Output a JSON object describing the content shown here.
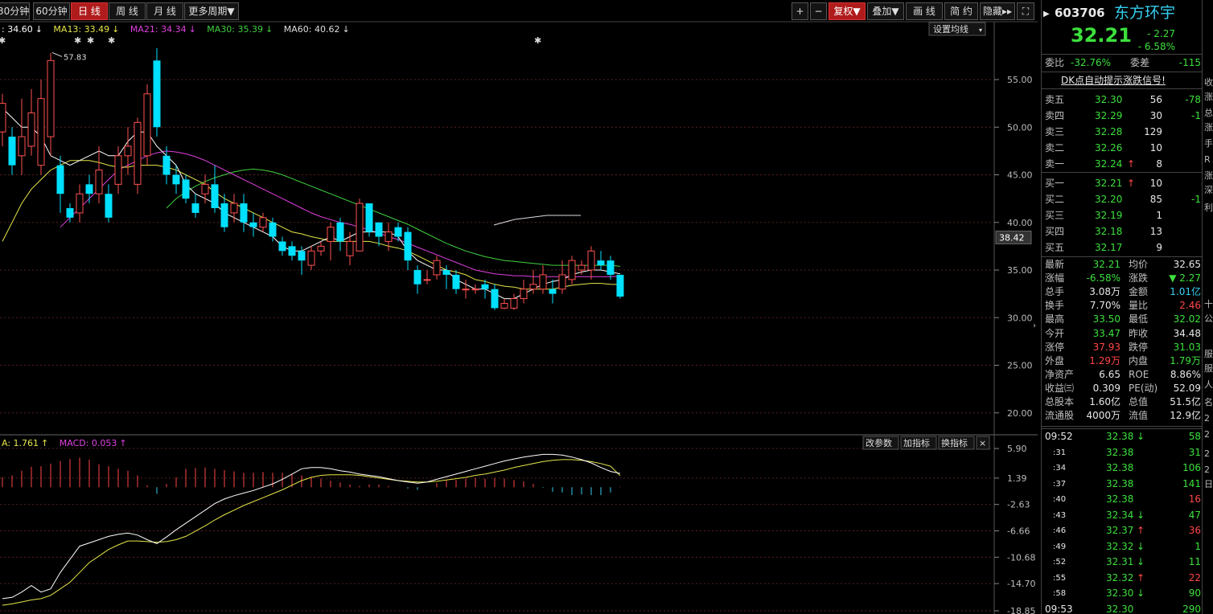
{
  "toolbar": {
    "periods": [
      {
        "label": "30分钟",
        "active": false
      },
      {
        "label": "60分钟",
        "active": false
      },
      {
        "label": "日 线",
        "active": true
      },
      {
        "label": "周 线",
        "active": false
      },
      {
        "label": "月 线",
        "active": false
      },
      {
        "label": "更多周期▼",
        "active": false
      }
    ],
    "right": [
      {
        "label": "+",
        "active": false
      },
      {
        "label": "−",
        "active": false
      },
      {
        "label": "复权▼",
        "active": true
      },
      {
        "label": "叠加▼",
        "active": false
      },
      {
        "label": "画 线",
        "active": false
      },
      {
        "label": "简 约",
        "active": false
      },
      {
        "label": "隐藏▸▸",
        "active": false
      },
      {
        "label": "⛶",
        "active": false
      }
    ]
  },
  "chart": {
    "settings_label": "设置均线",
    "ma_legend": [
      {
        "text": ": 34.60",
        "arrow": "↓",
        "color": "#ffffff"
      },
      {
        "text": "MA13: 33.49",
        "arrow": "↓",
        "color": "#e6e64a"
      },
      {
        "text": "MA21: 34.34",
        "arrow": "↓",
        "color": "#e040e0"
      },
      {
        "text": "MA30: 35.39",
        "arrow": "↓",
        "color": "#40d040"
      },
      {
        "text": "MA60: 40.62",
        "arrow": "↓",
        "color": "#dddddd"
      }
    ],
    "price_axis": [
      "55.00",
      "50.00",
      "45.00",
      "40.00",
      "35.00",
      "30.00",
      "25.00",
      "20.00"
    ],
    "current_price_tag": "38.42",
    "high_marker": "57.83",
    "macd_legend": [
      {
        "text": "A: 1.761",
        "arrow": "↑",
        "color": "#e6e64a"
      },
      {
        "text": "MACD: 0.053",
        "arrow": "↑",
        "color": "#e040e0"
      }
    ],
    "macd_buttons": [
      "改参数",
      "加指标",
      "换指标",
      "×"
    ],
    "macd_axis": [
      "5.90",
      "1.39",
      "-2.63",
      "-6.66",
      "-10.68",
      "-14.70",
      "-18.85"
    ]
  },
  "chart_data": {
    "type": "candlestick",
    "y_range": [
      17.5,
      58.5
    ],
    "candles": [
      [
        49.5,
        52.5,
        53.5,
        48
      ],
      [
        49,
        46,
        50,
        45
      ],
      [
        47,
        49,
        53,
        45
      ],
      [
        48,
        51.5,
        54,
        47
      ],
      [
        46,
        53,
        55,
        45
      ],
      [
        49,
        57,
        57.8,
        47
      ],
      [
        46,
        43,
        47,
        41
      ],
      [
        41.5,
        40.5,
        42,
        40
      ],
      [
        41,
        43,
        44,
        40
      ],
      [
        44,
        43,
        45,
        42
      ],
      [
        43,
        45.5,
        48,
        42
      ],
      [
        43,
        40.5,
        44,
        40
      ],
      [
        44,
        47,
        48,
        43
      ],
      [
        47,
        48,
        50,
        45
      ],
      [
        44,
        50.5,
        51,
        43
      ],
      [
        47,
        53.5,
        54.5,
        46
      ],
      [
        57,
        50,
        58.3,
        49
      ],
      [
        47,
        45,
        48,
        44
      ],
      [
        45,
        44,
        46,
        43
      ],
      [
        44.5,
        42.5,
        45,
        42
      ],
      [
        42,
        41,
        43,
        40.5
      ],
      [
        43,
        44,
        45,
        42
      ],
      [
        44,
        41.5,
        46,
        41
      ],
      [
        42,
        39.5,
        43,
        39
      ],
      [
        41,
        42,
        43,
        40
      ],
      [
        42,
        40,
        43,
        39
      ],
      [
        40,
        39.5,
        41,
        38.5
      ],
      [
        39.5,
        40.5,
        41,
        39
      ],
      [
        40,
        38.5,
        40.5,
        38
      ],
      [
        38,
        37,
        38.5,
        36.5
      ],
      [
        37.5,
        36.5,
        38,
        36
      ],
      [
        37,
        36,
        37.5,
        34.5
      ],
      [
        35.5,
        37,
        37.5,
        35
      ],
      [
        37,
        37.5,
        38,
        36.5
      ],
      [
        38,
        39.5,
        40,
        36
      ],
      [
        40,
        38,
        40.5,
        37
      ],
      [
        36.5,
        38,
        39,
        35.5
      ],
      [
        37,
        42,
        42.5,
        37
      ],
      [
        42,
        39,
        42,
        38.5
      ],
      [
        40,
        38.5,
        40,
        37.5
      ],
      [
        38,
        39,
        40,
        37
      ],
      [
        39.5,
        38.5,
        40,
        38
      ],
      [
        39,
        36,
        39.5,
        35
      ],
      [
        35,
        33.5,
        35.5,
        32.5
      ],
      [
        34,
        34,
        35,
        33.5
      ],
      [
        34.5,
        36,
        36.5,
        34
      ],
      [
        35,
        34.5,
        35.5,
        33
      ],
      [
        34.5,
        33,
        35,
        32.5
      ],
      [
        33,
        33,
        34,
        32
      ],
      [
        33,
        33,
        33.5,
        32.5
      ],
      [
        33.5,
        33,
        34,
        32
      ],
      [
        33,
        31,
        33.5,
        30.8
      ],
      [
        31,
        31.5,
        32,
        30.9
      ],
      [
        31,
        32,
        32.5,
        30.8
      ],
      [
        32,
        33,
        34,
        31.5
      ],
      [
        33,
        33.5,
        35,
        32.5
      ],
      [
        33,
        34.5,
        35.5,
        32.5
      ],
      [
        33,
        32.5,
        34,
        31.5
      ],
      [
        33,
        34.5,
        36,
        32.5
      ],
      [
        34,
        36,
        36.5,
        33.5
      ],
      [
        35,
        35.5,
        36,
        34.5
      ],
      [
        35,
        37,
        37.5,
        34
      ],
      [
        36,
        35.5,
        37,
        35
      ],
      [
        36,
        34.5,
        36.5,
        34
      ],
      [
        34.5,
        32.21,
        34.5,
        32.02
      ]
    ],
    "ma5": [
      52,
      51,
      50,
      50,
      49,
      47,
      46.5,
      46,
      46.5,
      47,
      47.5,
      47,
      47,
      48.5,
      49.5,
      49.5,
      48,
      47,
      46,
      44,
      43,
      42.5,
      42,
      41,
      40.5,
      40,
      39.5,
      39,
      38.5,
      37.5,
      37,
      37,
      37.5,
      38,
      38.5,
      38,
      38.5,
      39,
      39,
      39,
      39,
      38.5,
      37,
      36,
      35.5,
      35,
      35,
      34,
      33.5,
      33,
      33,
      32.5,
      32,
      32,
      32.5,
      33,
      33.5,
      33.8,
      34,
      34.5,
      34.8,
      35,
      35,
      34.8,
      34.6
    ],
    "ma13": [
      38,
      40,
      42,
      43.5,
      44.5,
      45.5,
      46,
      46.5,
      46.5,
      46.5,
      46.3,
      46,
      45.8,
      45.8,
      46,
      46,
      46,
      45.8,
      45.5,
      45,
      44.5,
      44,
      43.2,
      42.5,
      42,
      41.5,
      41,
      40.5,
      40,
      39.5,
      39,
      38.8,
      38.5,
      38.3,
      38,
      38,
      38,
      38,
      38,
      37.8,
      37.5,
      37.3,
      37,
      36.5,
      36,
      35.5,
      35,
      34.8,
      34.5,
      34,
      33.8,
      33.5,
      33.3,
      33.2,
      33,
      33,
      33,
      33,
      33.2,
      33.4,
      33.5,
      33.6,
      33.6,
      33.5,
      33.49
    ],
    "ma21": [
      null,
      null,
      null,
      null,
      null,
      null,
      39.5,
      40.5,
      41.5,
      42.5,
      43.5,
      44.5,
      45.5,
      46,
      46.5,
      47,
      47.3,
      47.5,
      47.4,
      47.2,
      46.9,
      46.5,
      46,
      45.5,
      45,
      44.5,
      44,
      43.5,
      43,
      42.5,
      42,
      41.5,
      41,
      40.6,
      40.3,
      40,
      39.8,
      39.5,
      39.2,
      38.9,
      38.5,
      38.2,
      37.8,
      37.4,
      37,
      36.6,
      36.2,
      35.8,
      35.4,
      35,
      34.8,
      34.6,
      34.5,
      34.4,
      34.4,
      34.3,
      34.3,
      34.3,
      34.3,
      34.3,
      34.3,
      34.3,
      34.3,
      34.3,
      34.34
    ],
    "ma30": [
      null,
      null,
      null,
      null,
      null,
      null,
      null,
      null,
      null,
      null,
      null,
      null,
      null,
      null,
      null,
      null,
      null,
      41.5,
      42.5,
      43.2,
      43.8,
      44.3,
      44.7,
      45,
      45.3,
      45.5,
      45.6,
      45.5,
      45.3,
      45,
      44.6,
      44.2,
      43.8,
      43.4,
      43,
      42.6,
      42.2,
      41.8,
      41.4,
      41,
      40.6,
      40.2,
      39.8,
      39.3,
      38.8,
      38.3,
      37.8,
      37.4,
      37,
      36.7,
      36.4,
      36.2,
      36,
      35.9,
      35.8,
      35.7,
      35.6,
      35.5,
      35.5,
      35.5,
      35.5,
      35.5,
      35.5,
      35.5,
      35.39
    ],
    "ma60": [
      null,
      null,
      null,
      null,
      null,
      null,
      null,
      null,
      null,
      null,
      null,
      null,
      null,
      null,
      null,
      null,
      null,
      null,
      null,
      null,
      null,
      null,
      null,
      null,
      null,
      null,
      null,
      null,
      null,
      null,
      null,
      null,
      null,
      null,
      null,
      null,
      null,
      null,
      null,
      null,
      null,
      null,
      null,
      null,
      null,
      null,
      null,
      null,
      null,
      null,
      null,
      39.9,
      40.1,
      40.3,
      40.45,
      40.55,
      40.62,
      40.62,
      40.62,
      40.62,
      40.62,
      40.62,
      40.62,
      40.62,
      40.62
    ],
    "macd_range": [
      -18.85,
      7.5
    ],
    "dif": [
      -17,
      -16.8,
      -16,
      -15,
      -16,
      -15.5,
      -13,
      -11,
      -9,
      -8.5,
      -8,
      -7.5,
      -7.2,
      -7,
      -7.3,
      -8,
      -8.6,
      -7.6,
      -6.5,
      -5.5,
      -4.5,
      -3.5,
      -2.5,
      -1.8,
      -1.3,
      -0.9,
      -0.5,
      0,
      0.5,
      1.2,
      2,
      2.8,
      3,
      3,
      2.8,
      2.5,
      2.3,
      2,
      1.8,
      1.6,
      1.3,
      1,
      0.8,
      0.6,
      0.8,
      1.2,
      1.6,
      2,
      2.4,
      2.8,
      3.2,
      3.6,
      4,
      4.3,
      4.6,
      4.8,
      5,
      5,
      4.9,
      4.6,
      4.2,
      3.7,
      3,
      2.4,
      2.1
    ],
    "dea": [
      -18,
      -17.8,
      -17.5,
      -17.2,
      -17,
      -16.5,
      -15.5,
      -14.5,
      -13,
      -11.5,
      -10.5,
      -9.5,
      -8.8,
      -8.2,
      -8.2,
      -8.3,
      -8.4,
      -8.3,
      -8,
      -7.5,
      -6.7,
      -5.9,
      -5,
      -4.2,
      -3.5,
      -2.8,
      -2.2,
      -1.6,
      -1,
      -0.4,
      0.3,
      1,
      1.5,
      1.8,
      1.9,
      1.9,
      1.9,
      1.8,
      1.6,
      1.4,
      1.2,
      1,
      0.9,
      0.8,
      0.8,
      0.9,
      1.1,
      1.3,
      1.5,
      1.8,
      2,
      2.3,
      2.6,
      3,
      3.3,
      3.6,
      3.9,
      4.1,
      4.2,
      4.2,
      4.1,
      3.9,
      3.6,
      3.2,
      1.761
    ],
    "macd_hist": [
      1.5,
      1.8,
      2.5,
      3.1,
      3.2,
      3.6,
      4,
      4.3,
      4.5,
      4.2,
      3.5,
      3.2,
      2.8,
      2.5,
      1.8,
      0.3,
      -1,
      0.5,
      1.5,
      2.8,
      2.9,
      3,
      2.8,
      2.6,
      2.4,
      2.2,
      2.2,
      2.3,
      2.2,
      2.2,
      2,
      1.8,
      1.6,
      1.3,
      1,
      0.7,
      0.4,
      0.2,
      0.4,
      0.4,
      0.2,
      0,
      -0.2,
      -0.4,
      0,
      0.6,
      1,
      1.1,
      1.3,
      1.4,
      1.3,
      1.4,
      1.3,
      1.1,
      0.9,
      0.5,
      -0.1,
      -0.7,
      -0.8,
      -1.2,
      -1.1,
      -1.2,
      -1.2,
      -0.8,
      0.053
    ]
  },
  "quote": {
    "code": "603706",
    "name": "东方环宇",
    "price": "32.21",
    "change": "- 2.27",
    "change_pct": "- 6.58%",
    "webi_label": "委比",
    "webi": "-32.76%",
    "wecha_label": "委差",
    "wecha": "-115",
    "notice": "DK点自动提示涨跌信号!",
    "asks": [
      {
        "label": "卖五",
        "price": "32.30",
        "vol": "56",
        "delta": "-78",
        "arrow": ""
      },
      {
        "label": "卖四",
        "price": "32.29",
        "vol": "30",
        "delta": "-1",
        "arrow": ""
      },
      {
        "label": "卖三",
        "price": "32.28",
        "vol": "129",
        "delta": "",
        "arrow": ""
      },
      {
        "label": "卖二",
        "price": "32.26",
        "vol": "10",
        "delta": "",
        "arrow": ""
      },
      {
        "label": "卖一",
        "price": "32.24",
        "vol": "8",
        "delta": "",
        "arrow": "↑"
      }
    ],
    "bids": [
      {
        "label": "买一",
        "price": "32.21",
        "vol": "10",
        "delta": "",
        "arrow": "↑"
      },
      {
        "label": "买二",
        "price": "32.20",
        "vol": "85",
        "delta": "-1",
        "arrow": ""
      },
      {
        "label": "买三",
        "price": "32.19",
        "vol": "1",
        "delta": "",
        "arrow": ""
      },
      {
        "label": "买四",
        "price": "32.18",
        "vol": "13",
        "delta": "",
        "arrow": ""
      },
      {
        "label": "买五",
        "price": "32.17",
        "vol": "9",
        "delta": "",
        "arrow": ""
      }
    ],
    "stats": [
      {
        "l1": "最新",
        "v1": "32.21",
        "c1": "g",
        "l2": "均价",
        "v2": "32.65",
        "c2": "w"
      },
      {
        "l1": "涨幅",
        "v1": "-6.58%",
        "c1": "g",
        "l2": "涨跌",
        "v2": "▼ 2.27",
        "c2": "g"
      },
      {
        "l1": "总手",
        "v1": "3.08万",
        "c1": "w",
        "l2": "金额",
        "v2": "1.01亿",
        "c2": "c"
      },
      {
        "l1": "换手",
        "v1": "7.70%",
        "c1": "w",
        "l2": "量比",
        "v2": "2.46",
        "c2": "r"
      },
      {
        "l1": "最高",
        "v1": "33.50",
        "c1": "g",
        "l2": "最低",
        "v2": "32.02",
        "c2": "g"
      },
      {
        "l1": "今开",
        "v1": "33.47",
        "c1": "g",
        "l2": "昨收",
        "v2": "34.48",
        "c2": "w"
      },
      {
        "l1": "涨停",
        "v1": "37.93",
        "c1": "r",
        "l2": "跌停",
        "v2": "31.03",
        "c2": "g"
      },
      {
        "l1": "外盘",
        "v1": "1.29万",
        "c1": "r",
        "l2": "内盘",
        "v2": "1.79万",
        "c2": "g"
      },
      {
        "l1": "净资产",
        "v1": "6.65",
        "c1": "w",
        "l2": "ROE",
        "v2": "8.86%",
        "c2": "w"
      },
      {
        "l1": "收益㈢",
        "v1": "0.309",
        "c1": "w",
        "l2": "PE(动)",
        "v2": "52.09",
        "c2": "w"
      },
      {
        "l1": "总股本",
        "v1": "1.60亿",
        "c1": "w",
        "l2": "总值",
        "v2": "51.5亿",
        "c2": "w"
      },
      {
        "l1": "流通股",
        "v1": "4000万",
        "c1": "w",
        "l2": "流值",
        "v2": "12.9亿",
        "c2": "w"
      }
    ],
    "ticks": [
      {
        "time": "09:52",
        "price": "32.38",
        "arrow": "↓",
        "vol": "58",
        "vc": "g"
      },
      {
        "time": ":31",
        "price": "32.38",
        "arrow": "",
        "vol": "31",
        "vc": "g"
      },
      {
        "time": ":34",
        "price": "32.38",
        "arrow": "",
        "vol": "106",
        "vc": "g"
      },
      {
        "time": ":37",
        "price": "32.38",
        "arrow": "",
        "vol": "141",
        "vc": "g"
      },
      {
        "time": ":40",
        "price": "32.38",
        "arrow": "",
        "vol": "16",
        "vc": "r"
      },
      {
        "time": ":43",
        "price": "32.34",
        "arrow": "↓",
        "vol": "47",
        "vc": "g"
      },
      {
        "time": ":46",
        "price": "32.37",
        "arrow": "↑",
        "vol": "36",
        "vc": "r"
      },
      {
        "time": ":49",
        "price": "32.32",
        "arrow": "↓",
        "vol": "1",
        "vc": "g"
      },
      {
        "time": ":52",
        "price": "32.31",
        "arrow": "↓",
        "vol": "11",
        "vc": "g"
      },
      {
        "time": ":55",
        "price": "32.32",
        "arrow": "↑",
        "vol": "22",
        "vc": "r"
      },
      {
        "time": ":58",
        "price": "32.30",
        "arrow": "↓",
        "vol": "90",
        "vc": "g"
      },
      {
        "time": "09:53",
        "price": "32.30",
        "arrow": "",
        "vol": "290",
        "vc": "g"
      }
    ]
  },
  "edge_labels": [
    "收",
    "涨",
    "总",
    "涨",
    "手",
    "R",
    "涨",
    "深",
    "利",
    "十",
    "公",
    "服",
    "服",
    "人",
    "名",
    "2",
    "2",
    "2",
    "2",
    "日"
  ]
}
